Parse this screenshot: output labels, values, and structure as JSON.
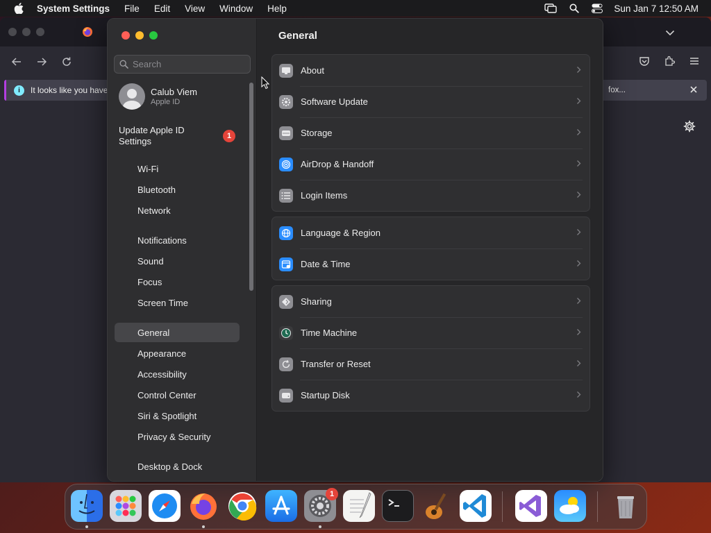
{
  "menubar": {
    "app_name": "System Settings",
    "items": [
      "File",
      "Edit",
      "View",
      "Window",
      "Help"
    ],
    "clock": "Sun Jan 7  12:50 AM"
  },
  "browser": {
    "notice_text": "It looks like you have",
    "notice_right": "fox..."
  },
  "settings": {
    "search_placeholder": "Search",
    "account": {
      "name": "Calub Viem",
      "subtitle": "Apple ID"
    },
    "update_label": "Update Apple ID Settings",
    "update_badge": "1",
    "sidebar_items": [
      "Wi-Fi",
      "Bluetooth",
      "Network",
      "Notifications",
      "Sound",
      "Focus",
      "Screen Time",
      "General",
      "Appearance",
      "Accessibility",
      "Control Center",
      "Siri & Spotlight",
      "Privacy & Security",
      "Desktop & Dock"
    ],
    "selected_item": "General",
    "main_title": "General",
    "groups": [
      [
        "About",
        "Software Update",
        "Storage",
        "AirDrop & Handoff",
        "Login Items"
      ],
      [
        "Language & Region",
        "Date & Time"
      ],
      [
        "Sharing",
        "Time Machine",
        "Transfer or Reset",
        "Startup Disk"
      ]
    ]
  },
  "dock": {
    "apps": [
      "Finder",
      "Launchpad",
      "Safari",
      "Firefox",
      "Chrome",
      "App Store",
      "System Settings",
      "TextEdit",
      "Terminal",
      "GarageBand",
      "Visual Studio Code",
      "Visual Studio",
      "Weather",
      "Trash"
    ],
    "settings_badge": "1"
  },
  "colors": {
    "accent_red": "#e5443a",
    "traffic_red": "#ff5f57",
    "traffic_yellow": "#febc2e",
    "traffic_green": "#28c840",
    "selected_bg": "#464649"
  }
}
